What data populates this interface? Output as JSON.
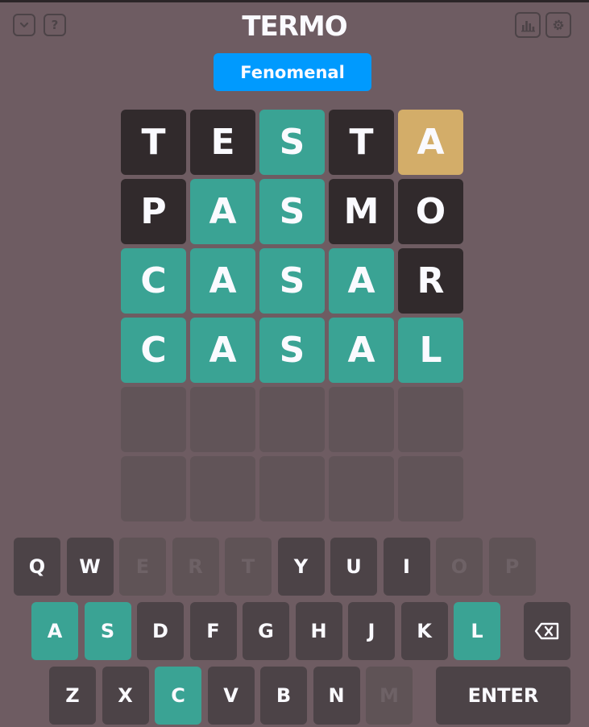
{
  "header": {
    "title": "TERMO",
    "left_buttons": [
      {
        "icon": "chevron-down-icon",
        "label": "⌄"
      },
      {
        "icon": "help-icon",
        "label": "?"
      }
    ],
    "right_buttons": [
      {
        "icon": "stats-icon"
      },
      {
        "icon": "gear-icon"
      }
    ]
  },
  "toast": "Fenomenal",
  "board": [
    [
      {
        "l": "T",
        "s": "wrong"
      },
      {
        "l": "E",
        "s": "wrong"
      },
      {
        "l": "S",
        "s": "right"
      },
      {
        "l": "T",
        "s": "wrong"
      },
      {
        "l": "A",
        "s": "place"
      }
    ],
    [
      {
        "l": "P",
        "s": "wrong"
      },
      {
        "l": "A",
        "s": "right"
      },
      {
        "l": "S",
        "s": "right"
      },
      {
        "l": "M",
        "s": "wrong"
      },
      {
        "l": "O",
        "s": "wrong"
      }
    ],
    [
      {
        "l": "C",
        "s": "right"
      },
      {
        "l": "A",
        "s": "right"
      },
      {
        "l": "S",
        "s": "right"
      },
      {
        "l": "A",
        "s": "right"
      },
      {
        "l": "R",
        "s": "wrong"
      }
    ],
    [
      {
        "l": "C",
        "s": "right"
      },
      {
        "l": "A",
        "s": "right"
      },
      {
        "l": "S",
        "s": "right"
      },
      {
        "l": "A",
        "s": "right"
      },
      {
        "l": "L",
        "s": "right"
      }
    ],
    [
      {
        "l": "",
        "s": "empty"
      },
      {
        "l": "",
        "s": "empty"
      },
      {
        "l": "",
        "s": "empty"
      },
      {
        "l": "",
        "s": "empty"
      },
      {
        "l": "",
        "s": "empty"
      }
    ],
    [
      {
        "l": "",
        "s": "empty"
      },
      {
        "l": "",
        "s": "empty"
      },
      {
        "l": "",
        "s": "empty"
      },
      {
        "l": "",
        "s": "empty"
      },
      {
        "l": "",
        "s": "empty"
      }
    ]
  ],
  "keyboard": {
    "row1": [
      {
        "k": "Q",
        "s": "normal"
      },
      {
        "k": "W",
        "s": "normal"
      },
      {
        "k": "E",
        "s": "nil"
      },
      {
        "k": "R",
        "s": "nil"
      },
      {
        "k": "T",
        "s": "nil"
      },
      {
        "k": "Y",
        "s": "normal"
      },
      {
        "k": "U",
        "s": "normal"
      },
      {
        "k": "I",
        "s": "normal"
      },
      {
        "k": "O",
        "s": "nil"
      },
      {
        "k": "P",
        "s": "nil"
      }
    ],
    "row2": [
      {
        "k": "A",
        "s": "right"
      },
      {
        "k": "S",
        "s": "right"
      },
      {
        "k": "D",
        "s": "normal"
      },
      {
        "k": "F",
        "s": "normal"
      },
      {
        "k": "G",
        "s": "normal"
      },
      {
        "k": "H",
        "s": "normal"
      },
      {
        "k": "J",
        "s": "normal"
      },
      {
        "k": "K",
        "s": "normal"
      },
      {
        "k": "L",
        "s": "right"
      }
    ],
    "row3": [
      {
        "k": "Z",
        "s": "normal"
      },
      {
        "k": "X",
        "s": "normal"
      },
      {
        "k": "C",
        "s": "right"
      },
      {
        "k": "V",
        "s": "normal"
      },
      {
        "k": "B",
        "s": "normal"
      },
      {
        "k": "N",
        "s": "normal"
      },
      {
        "k": "M",
        "s": "nil"
      }
    ],
    "enter_label": "ENTER",
    "backspace_icon": "backspace-icon"
  },
  "colors": {
    "background": "#6e5c62",
    "right": "#3aa394",
    "place": "#d3ad69",
    "wrong": "#312a2c",
    "toast": "#009afe"
  }
}
